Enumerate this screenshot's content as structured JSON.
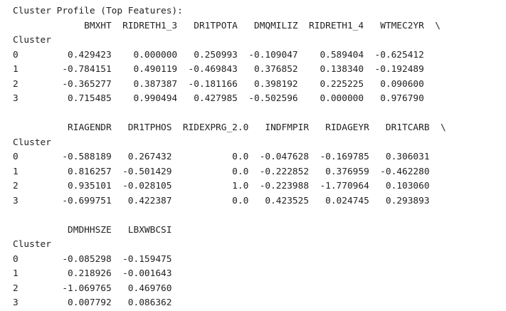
{
  "output": {
    "header": "Cluster Profile (Top Features):",
    "index_name": "Cluster",
    "continuation_mark": "\\",
    "blocks": [
      {
        "columns": [
          "BMXHT",
          "RIDRETH1_3",
          "DR1TPOTA",
          "DMQMILIZ",
          "RIDRETH1_4",
          "WTMEC2YR"
        ],
        "continued": true,
        "rows": [
          {
            "cluster": "0",
            "values": [
              "0.429423",
              "0.000000",
              "0.250993",
              "-0.109047",
              "0.589404",
              "-0.625412"
            ]
          },
          {
            "cluster": "1",
            "values": [
              "-0.784151",
              "0.490119",
              "-0.469843",
              "0.376852",
              "0.138340",
              "-0.192489"
            ]
          },
          {
            "cluster": "2",
            "values": [
              "-0.365277",
              "0.387387",
              "-0.181166",
              "0.398192",
              "0.225225",
              "0.090600"
            ]
          },
          {
            "cluster": "3",
            "values": [
              "0.715485",
              "0.990494",
              "0.427985",
              "-0.502596",
              "0.000000",
              "0.976790"
            ]
          }
        ]
      },
      {
        "columns": [
          "RIAGENDR",
          "DR1TPHOS",
          "RIDEXPRG_2.0",
          "INDFMPIR",
          "RIDAGEYR",
          "DR1TCARB"
        ],
        "continued": true,
        "rows": [
          {
            "cluster": "0",
            "values": [
              "-0.588189",
              "0.267432",
              "0.0",
              "-0.047628",
              "-0.169785",
              "0.306031"
            ]
          },
          {
            "cluster": "1",
            "values": [
              "0.816257",
              "-0.501429",
              "0.0",
              "-0.222852",
              "0.376959",
              "-0.462280"
            ]
          },
          {
            "cluster": "2",
            "values": [
              "0.935101",
              "-0.028105",
              "1.0",
              "-0.223988",
              "-1.770964",
              "0.103060"
            ]
          },
          {
            "cluster": "3",
            "values": [
              "-0.699751",
              "0.422387",
              "0.0",
              "0.423525",
              "0.024745",
              "0.293893"
            ]
          }
        ]
      },
      {
        "columns": [
          "DMDHHSZE",
          "LBXWBCSI"
        ],
        "continued": false,
        "rows": [
          {
            "cluster": "0",
            "values": [
              "-0.085298",
              "-0.159475"
            ]
          },
          {
            "cluster": "1",
            "values": [
              "0.218926",
              "-0.001643"
            ]
          },
          {
            "cluster": "2",
            "values": [
              "-1.069765",
              "0.469760"
            ]
          },
          {
            "cluster": "3",
            "values": [
              "0.007792",
              "0.086362"
            ]
          }
        ]
      }
    ]
  }
}
